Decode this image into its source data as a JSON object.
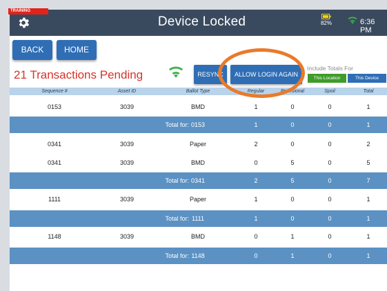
{
  "training_label": "TRAINING",
  "topbar": {
    "title": "Device Locked",
    "battery_pct": "82%",
    "time": "6:36 PM"
  },
  "nav": {
    "back": "BACK",
    "home": "HOME"
  },
  "pending_text": "21 Transactions Pending",
  "buttons": {
    "resync": "RESYNC",
    "allow_login": "ALLOW LOGIN AGAIN"
  },
  "include_totals": {
    "label": "Include Totals For",
    "this_location": "This Location",
    "this_device": "This Device"
  },
  "columns": [
    "Sequence #",
    "Asset ID",
    "Ballot Type",
    "Regular",
    "Provisional",
    "Spoil",
    "Total"
  ],
  "rows": [
    {
      "kind": "data",
      "seq": "0153",
      "asset": "3039",
      "type": "BMD",
      "regular": "1",
      "provisional": "0",
      "spoil": "0",
      "total": "1"
    },
    {
      "kind": "total",
      "label": "Total for:",
      "seq": "0153",
      "regular": "1",
      "provisional": "0",
      "spoil": "0",
      "total": "1"
    },
    {
      "kind": "data",
      "seq": "0341",
      "asset": "3039",
      "type": "Paper",
      "regular": "2",
      "provisional": "0",
      "spoil": "0",
      "total": "2"
    },
    {
      "kind": "data",
      "seq": "0341",
      "asset": "3039",
      "type": "BMD",
      "regular": "0",
      "provisional": "5",
      "spoil": "0",
      "total": "5"
    },
    {
      "kind": "total",
      "label": "Total for:",
      "seq": "0341",
      "regular": "2",
      "provisional": "5",
      "spoil": "0",
      "total": "7"
    },
    {
      "kind": "data",
      "seq": "1111",
      "asset": "3039",
      "type": "Paper",
      "regular": "1",
      "provisional": "0",
      "spoil": "0",
      "total": "1"
    },
    {
      "kind": "total",
      "label": "Total for:",
      "seq": "1111",
      "regular": "1",
      "provisional": "0",
      "spoil": "0",
      "total": "1"
    },
    {
      "kind": "data",
      "seq": "1148",
      "asset": "3039",
      "type": "BMD",
      "regular": "0",
      "provisional": "1",
      "spoil": "0",
      "total": "1"
    },
    {
      "kind": "total",
      "label": "Total for:",
      "seq": "1148",
      "regular": "0",
      "provisional": "1",
      "spoil": "0",
      "total": "1"
    }
  ],
  "colors": {
    "topbar": "#3a4a5e",
    "button_blue": "#2f6eb5",
    "pending_red": "#d6332a",
    "location_green": "#3f9b2a",
    "total_row": "#5b91c3",
    "header_row": "#b8d3eb",
    "highlight_orange": "#ea7a2a"
  },
  "icons": {
    "settings": "gear-icon",
    "battery": "battery-icon",
    "wifi": "wifi-icon"
  }
}
